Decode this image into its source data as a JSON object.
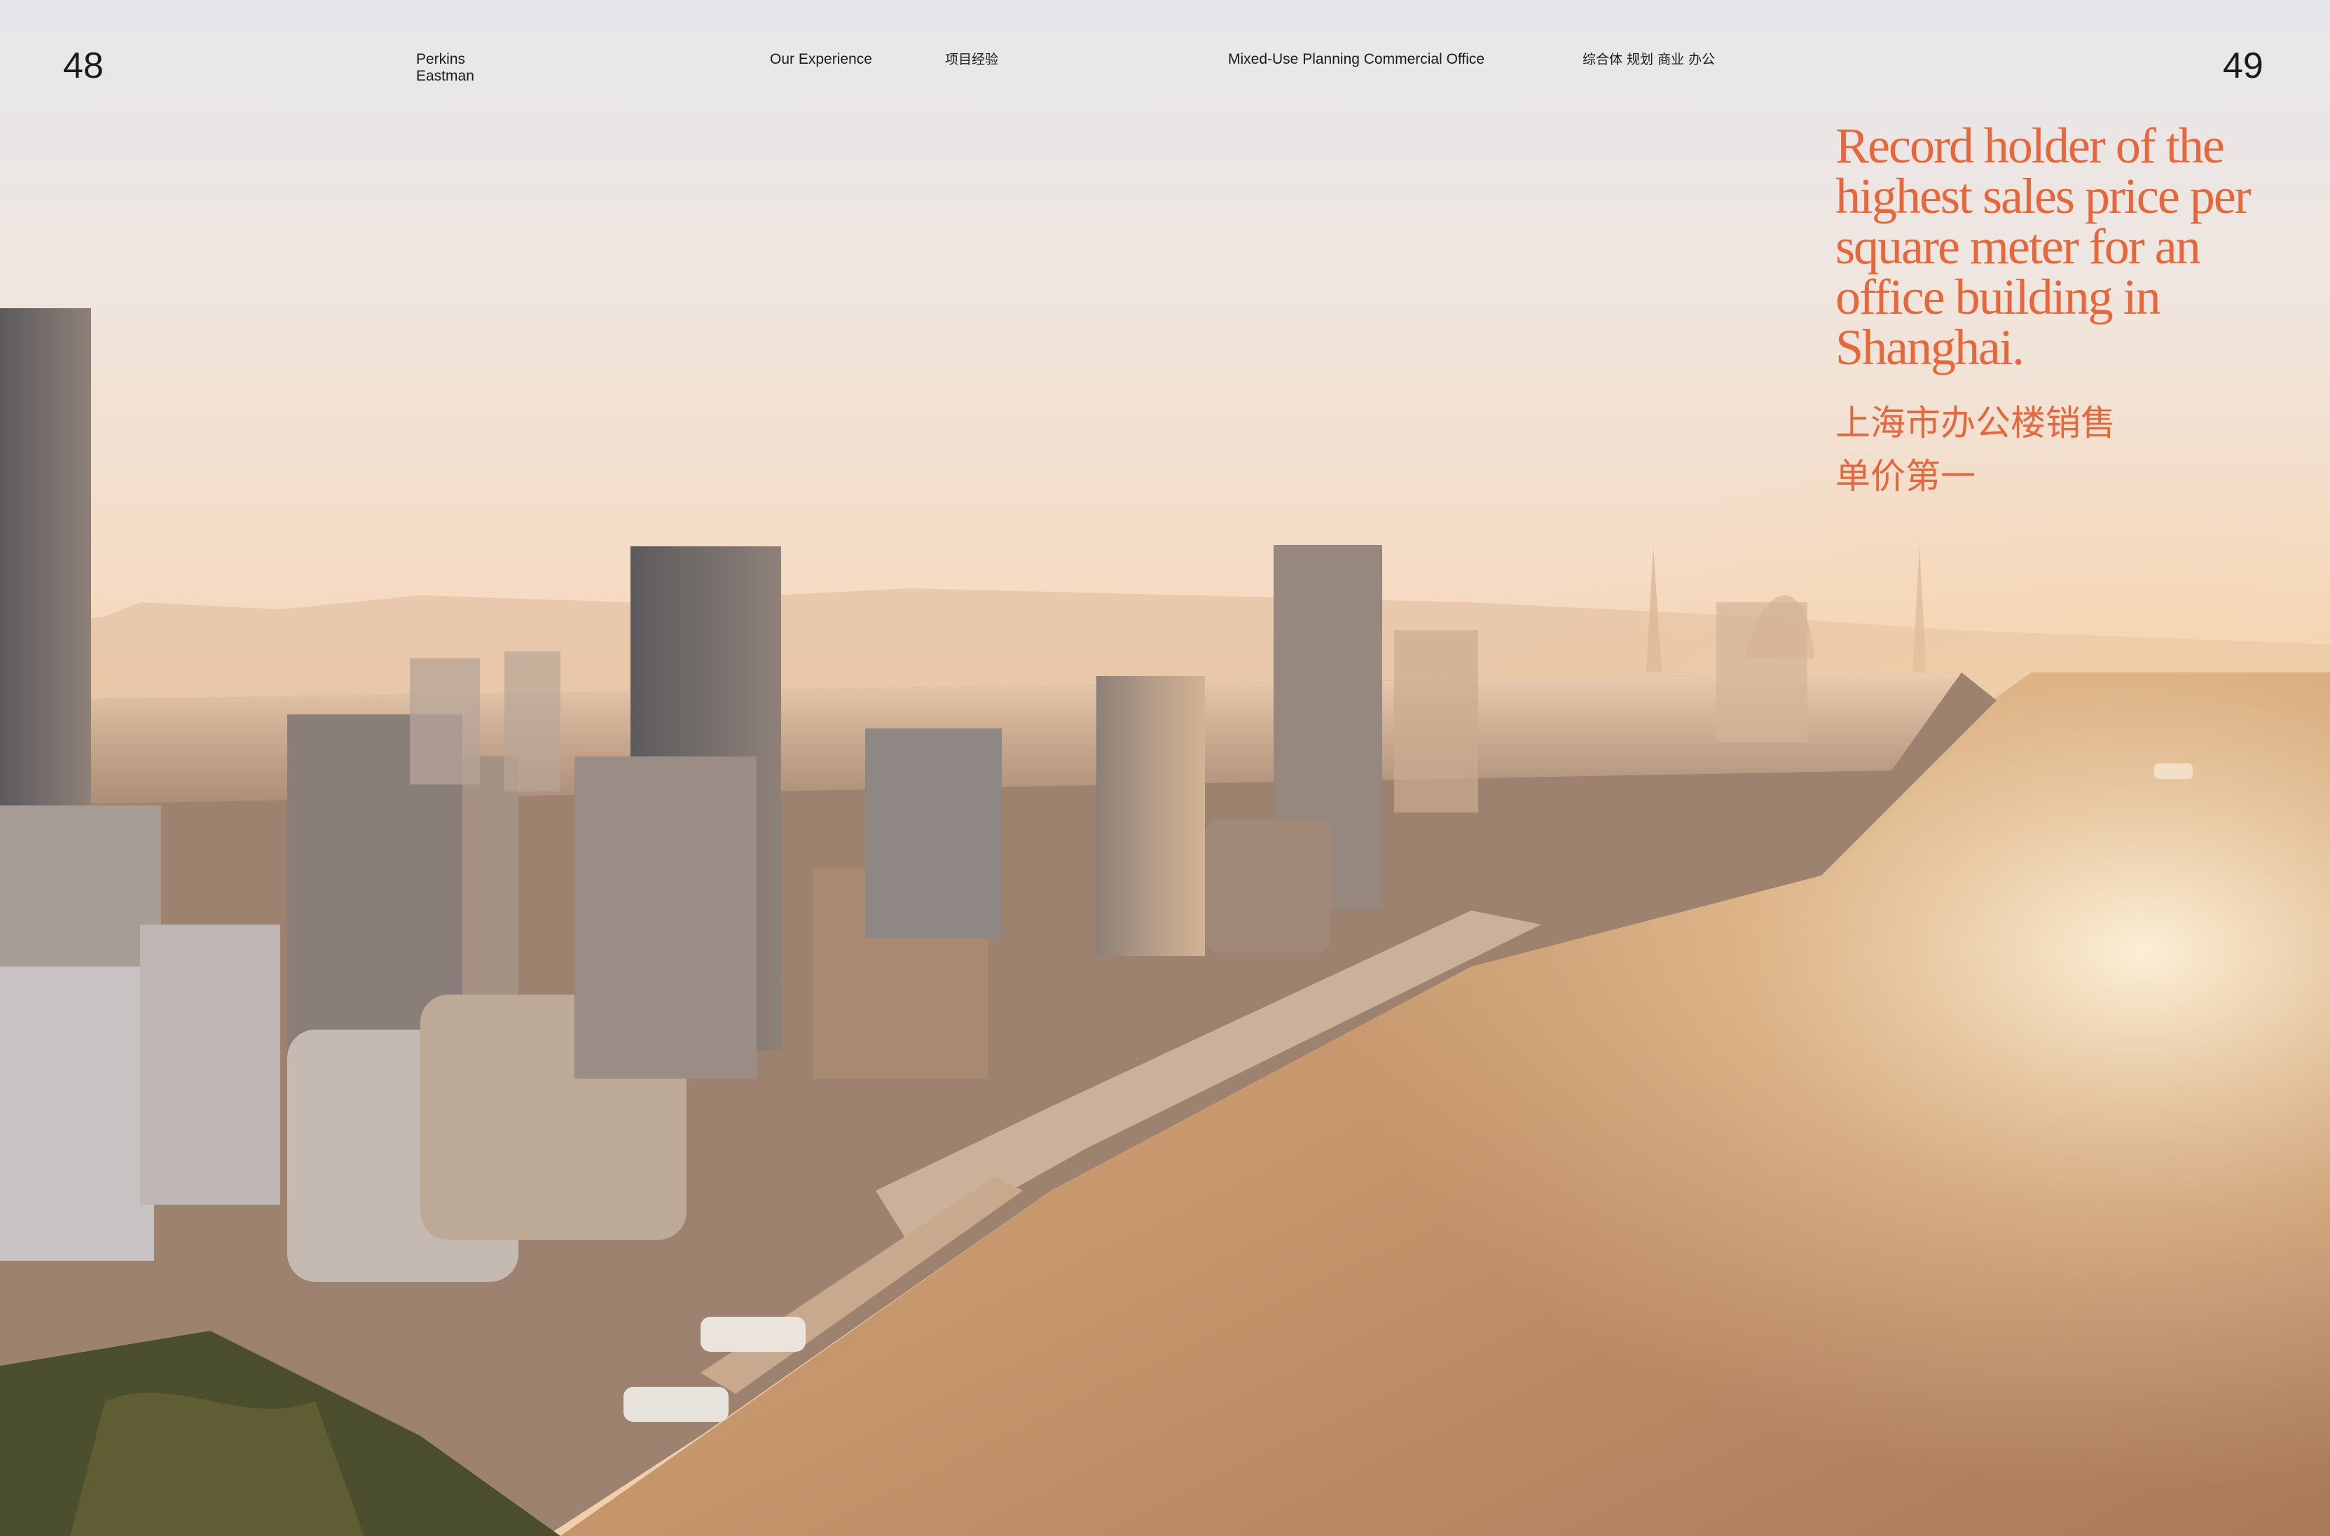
{
  "header": {
    "page_left": "48",
    "page_right": "49",
    "brand_line1": "Perkins",
    "brand_line2": "Eastman",
    "section_en": "Our Experience",
    "section_cn": "项目经验",
    "category_en": "Mixed-Use Planning Commercial Office",
    "category_cn": "综合体 规划 商业 办公"
  },
  "feature": {
    "headline": "Record holder of the highest sales price per square meter for an office building in Shanghai.",
    "headline_cn_line1": "上海市办公楼销售",
    "headline_cn_line2": "单价第一"
  },
  "colors": {
    "accent": "#e8673a",
    "river": "#c9986d",
    "sky": "#f2d9c2"
  }
}
